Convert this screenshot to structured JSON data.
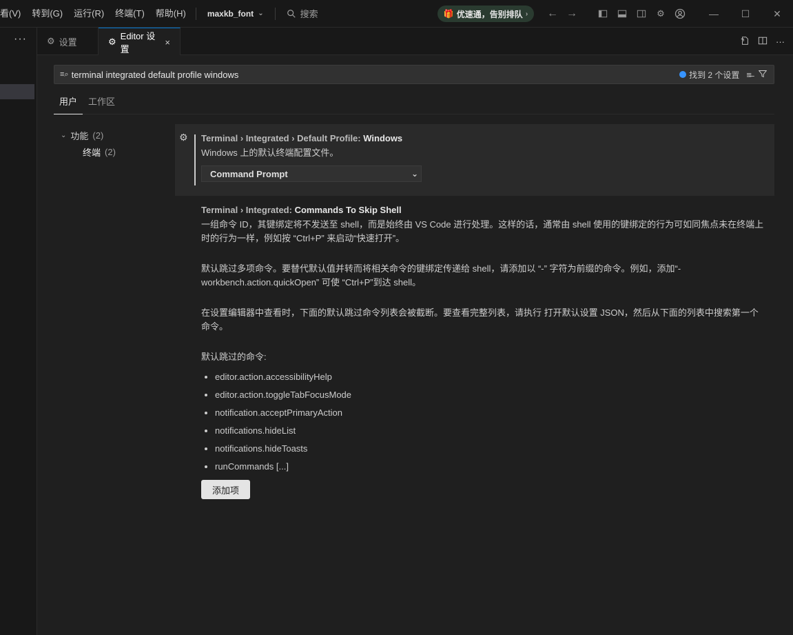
{
  "menu": [
    "看(V)",
    "转到(G)",
    "运行(R)",
    "终端(T)",
    "帮助(H)"
  ],
  "project": "maxkb_font",
  "top_search": "搜索",
  "promo": "优速通，告别排队",
  "tabs": {
    "settings": "设置",
    "editor_settings": "Editor 设置",
    "close": "×"
  },
  "search": {
    "value": "terminal integrated default profile windows",
    "found": "找到 2 个设置"
  },
  "scope_tabs": [
    "用户",
    "工作区"
  ],
  "toc": {
    "feature": "功能",
    "feature_count": "(2)",
    "terminal": "终端",
    "terminal_count": "(2)"
  },
  "setting1": {
    "path": "Terminal › Integrated › Default Profile: ",
    "key": "Windows",
    "description": "Windows 上的默认终端配置文件。",
    "value": "Command Prompt"
  },
  "setting2": {
    "path": "Terminal › Integrated: ",
    "key": "Commands To Skip Shell",
    "p1": "一组命令 ID，其键绑定将不发送至 shell，而是始终由 VS Code 进行处理。这样的话，通常由 shell 使用的键绑定的行为可如同焦点未在终端上时的行为一样，例如按 “Ctrl+P” 来启动“快速打开”。",
    "p2": "默认跳过多项命令。要替代默认值并转而将相关命令的键绑定传递给 shell，请添加以 “-” 字符为前缀的命令。例如，添加“-workbench.action.quickOpen” 可使 “Ctrl+P”到达 shell。",
    "p3": "在设置编辑器中查看时，下面的默认跳过命令列表会被截断。要查看完整列表，请执行 打开默认设置 JSON，然后从下面的列表中搜索第一个命令。",
    "list_heading": "默认跳过的命令:",
    "commands": [
      "editor.action.accessibilityHelp",
      "editor.action.toggleTabFocusMode",
      "notification.acceptPrimaryAction",
      "notifications.hideList",
      "notifications.hideToasts",
      "runCommands [...]"
    ],
    "add_button": "添加项"
  }
}
